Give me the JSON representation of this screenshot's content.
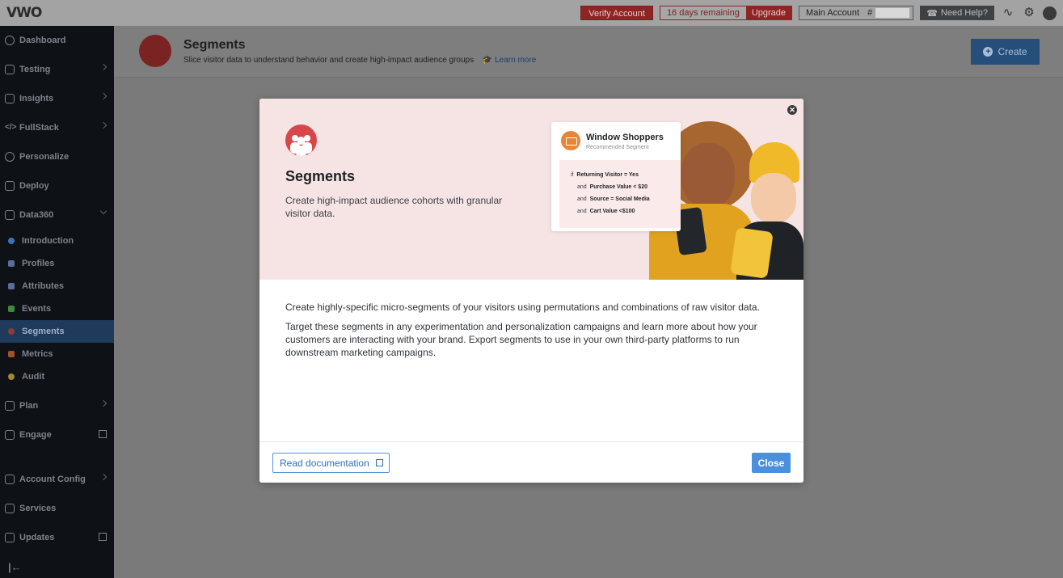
{
  "app": {
    "logo_text": "VWO"
  },
  "topbar": {
    "verify_label": "Verify Account",
    "trial_days": "16 days remaining",
    "upgrade_label": "Upgrade",
    "account_label": "Main Account",
    "account_hash": "#",
    "help_label": "Need Help?"
  },
  "sidebar": {
    "items": [
      {
        "label": "Dashboard"
      },
      {
        "label": "Testing"
      },
      {
        "label": "Insights"
      },
      {
        "label": "FullStack"
      },
      {
        "label": "Personalize"
      },
      {
        "label": "Deploy"
      },
      {
        "label": "Data360"
      },
      {
        "label": "Plan"
      },
      {
        "label": "Engage"
      },
      {
        "label": "Account Config"
      },
      {
        "label": "Services"
      },
      {
        "label": "Updates"
      }
    ],
    "data360_items": [
      {
        "label": "Introduction",
        "color": "#3b73b9"
      },
      {
        "label": "Profiles",
        "color": "#5b6d9a"
      },
      {
        "label": "Attributes",
        "color": "#5b6d9a"
      },
      {
        "label": "Events",
        "color": "#3b8a3b"
      },
      {
        "label": "Segments",
        "color": "#8a3b3b"
      },
      {
        "label": "Metrics",
        "color": "#a0522d"
      },
      {
        "label": "Audit",
        "color": "#a08a2d"
      }
    ],
    "collapse_glyph": "|←"
  },
  "header": {
    "title": "Segments",
    "subtitle": "Slice visitor data to understand behavior and create high-impact audience groups",
    "learn_more": "Learn more",
    "create_label": "Create"
  },
  "modal": {
    "title": "Segments",
    "description": "Create high-impact audience cohorts with granular visitor data.",
    "card": {
      "title": "Window Shoppers",
      "subtitle": "Recommended Segment",
      "rules": [
        {
          "prefix": "if",
          "text": "Returning Visitor = Yes"
        },
        {
          "prefix": "and",
          "text": "Purchase Value < $20"
        },
        {
          "prefix": "and",
          "text": "Source = Social Media"
        },
        {
          "prefix": "and",
          "text": "Cart Value <$100"
        }
      ]
    },
    "body": [
      "Create highly-specific micro-segments of your visitors using permutations and combinations of raw visitor data.",
      "Target these segments in any experimentation and personalization campaigns and learn more about how your customers are interacting with your brand. Export segments to use in your own third-party platforms to run downstream marketing campaigns."
    ],
    "read_docs_label": "Read documentation",
    "close_label": "Close"
  },
  "colors": {
    "brand_red": "#d7474a",
    "accent_blue": "#4a90dc",
    "hero_bg": "#f6e4e4"
  }
}
